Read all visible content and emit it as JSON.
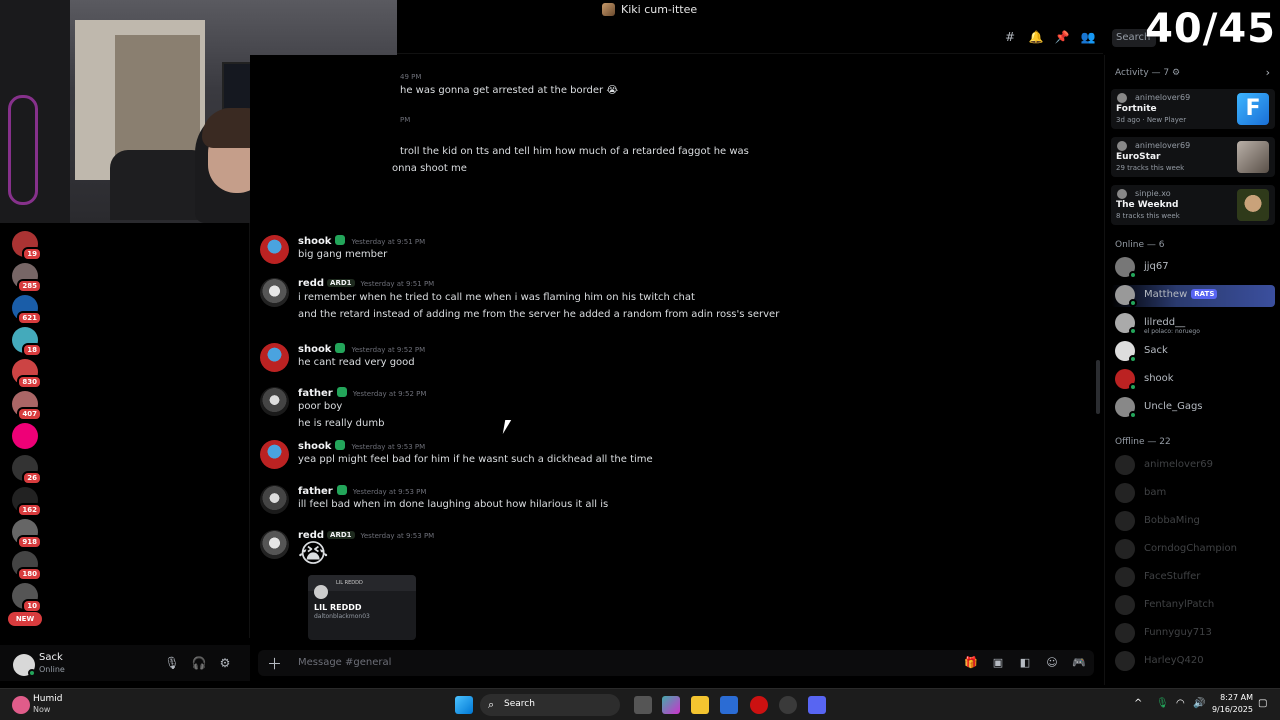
{
  "window": {
    "title": "Kiki cum-ittee"
  },
  "overlay": {
    "counter": "40/45"
  },
  "header": {
    "search_placeholder": "Search"
  },
  "servers": [
    {
      "badge": "19"
    },
    {
      "badge": "285"
    },
    {
      "badge": "621"
    },
    {
      "badge": "18"
    },
    {
      "badge": "830"
    },
    {
      "badge": "407"
    },
    {
      "badge": ""
    },
    {
      "badge": "26"
    },
    {
      "badge": "162"
    },
    {
      "badge": "918"
    },
    {
      "badge": "180"
    },
    {
      "badge": "10"
    }
  ],
  "new_pill": "NEW",
  "user": {
    "name": "Sack",
    "status": "Online"
  },
  "messages": {
    "partial": [
      {
        "ts": "49 PM",
        "text": "he was gonna get arrested at the border 😭"
      },
      {
        "ts": "PM",
        "text": "troll the kid on tts and tell him how much of a retarded faggot he was"
      },
      {
        "ts": "",
        "text": "onna shoot me"
      }
    ],
    "list": [
      {
        "author": "shook",
        "tag": "",
        "ts": "Yesterday at 9:51 PM",
        "lines": [
          "big gang member"
        ]
      },
      {
        "author": "redd",
        "tag": "ARD1",
        "ts": "Yesterday at 9:51 PM",
        "lines": [
          "i remember when he tried to call me when i was flaming him on his twitch chat",
          "and the retard instead of adding me from the server he added a random from adin ross's server"
        ]
      },
      {
        "author": "shook",
        "tag": "",
        "ts": "Yesterday at 9:52 PM",
        "lines": [
          "he cant read very good"
        ]
      },
      {
        "author": "father",
        "tag": "",
        "ts": "Yesterday at 9:52 PM",
        "lines": [
          "poor boy",
          "he is really dumb"
        ]
      },
      {
        "author": "shook",
        "tag": "",
        "ts": "Yesterday at 9:53 PM",
        "lines": [
          "yea ppl might feel bad for him if he wasnt such a dickhead all the time"
        ]
      },
      {
        "author": "father",
        "tag": "",
        "ts": "Yesterday at 9:53 PM",
        "lines": [
          "ill feel bad when im done laughing about how hilarious it all is"
        ]
      },
      {
        "author": "redd",
        "tag": "ARD1",
        "ts": "Yesterday at 9:53 PM",
        "lines": [
          "😭"
        ]
      }
    ],
    "attachment": {
      "top": "LIL REDDD",
      "title": "LIL REDDD",
      "sub": "daltonblackmon03"
    }
  },
  "composer": {
    "placeholder": "Message #general"
  },
  "members": {
    "activity_header": "Activity — 7",
    "activities": [
      {
        "user": "animelover69",
        "title": "Fortnite",
        "sub": "3d ago · New Player",
        "art": "F"
      },
      {
        "user": "animelover69",
        "title": "EuroStar",
        "sub": "29 tracks this week",
        "art": ""
      },
      {
        "user": "sinpie.xo",
        "title": "The Weeknd",
        "sub": "8 tracks this week",
        "art": ""
      }
    ],
    "online_header": "Online — 6",
    "online": [
      {
        "name": "jjq67",
        "sub": ""
      },
      {
        "name": "Matthew",
        "sub": "",
        "badge": "RATS"
      },
      {
        "name": "lilredd__",
        "sub": "el polaco: noruego"
      },
      {
        "name": "Sack",
        "sub": ""
      },
      {
        "name": "shook",
        "sub": ""
      },
      {
        "name": "Uncle_Gags",
        "sub": ""
      }
    ],
    "offline_header": "Offline — 22",
    "offline": [
      {
        "name": "animelover69"
      },
      {
        "name": "bam"
      },
      {
        "name": "BobbaMing"
      },
      {
        "name": "CorndogChampion"
      },
      {
        "name": "FaceStuffer"
      },
      {
        "name": "FentanylPatch"
      },
      {
        "name": "Funnyguy713"
      },
      {
        "name": "HarleyQ420"
      }
    ]
  },
  "taskbar": {
    "weather_title": "Humid",
    "weather_sub": "Now",
    "search_label": "Search",
    "time": "8:27 AM",
    "date": "9/16/2025"
  }
}
